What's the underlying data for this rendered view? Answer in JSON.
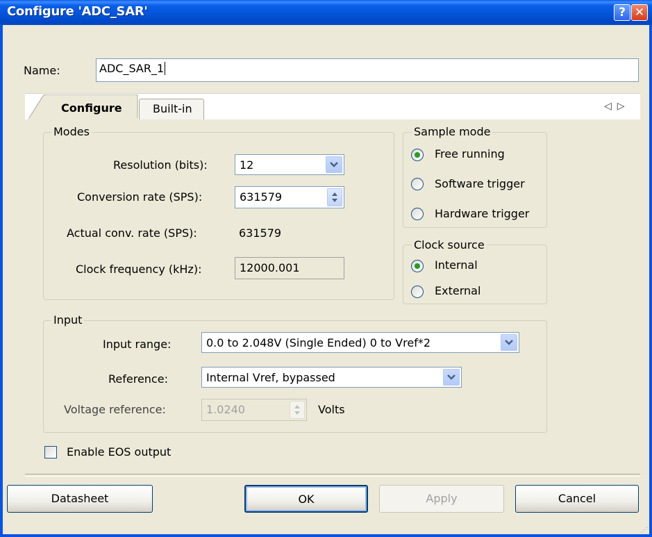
{
  "window": {
    "title": "Configure 'ADC_SAR'",
    "help_label": "?",
    "close_label": "✕"
  },
  "name": {
    "label": "Name:",
    "value": "ADC_SAR_1"
  },
  "tabs": [
    {
      "label": "Configure",
      "active": true
    },
    {
      "label": "Built-in",
      "active": false
    }
  ],
  "tab_scroll": {
    "left": "◁",
    "right": "▷"
  },
  "modes": {
    "legend": "Modes",
    "resolution_label": "Resolution (bits):",
    "resolution_value": "12",
    "conversion_rate_label": "Conversion rate (SPS):",
    "conversion_rate_value": "631579",
    "actual_rate_label": "Actual conv. rate (SPS):",
    "actual_rate_value": "631579",
    "clock_freq_label": "Clock frequency (kHz):",
    "clock_freq_value": "12000.001"
  },
  "sample_mode": {
    "legend": "Sample mode",
    "options": [
      {
        "label": "Free running",
        "checked": true
      },
      {
        "label": "Software trigger",
        "checked": false
      },
      {
        "label": "Hardware trigger",
        "checked": false
      }
    ]
  },
  "clock_source": {
    "legend": "Clock source",
    "options": [
      {
        "label": "Internal",
        "checked": true
      },
      {
        "label": "External",
        "checked": false
      }
    ]
  },
  "input": {
    "legend": "Input",
    "range_label": "Input range:",
    "range_value": "0.0 to 2.048V (Single Ended) 0 to Vref*2",
    "reference_label": "Reference:",
    "reference_value": "Internal Vref, bypassed",
    "voltage_ref_label": "Voltage reference:",
    "voltage_ref_value": "1.0240",
    "voltage_ref_unit": "Volts"
  },
  "eos": {
    "label": "Enable EOS output",
    "checked": false
  },
  "buttons": {
    "datasheet": "Datasheet",
    "ok": "OK",
    "apply": "Apply",
    "cancel": "Cancel"
  },
  "colors": {
    "titlebar": "#0a54e0",
    "dialog_bg": "#ece9d8",
    "radio_dot": "#2a9a2a"
  }
}
